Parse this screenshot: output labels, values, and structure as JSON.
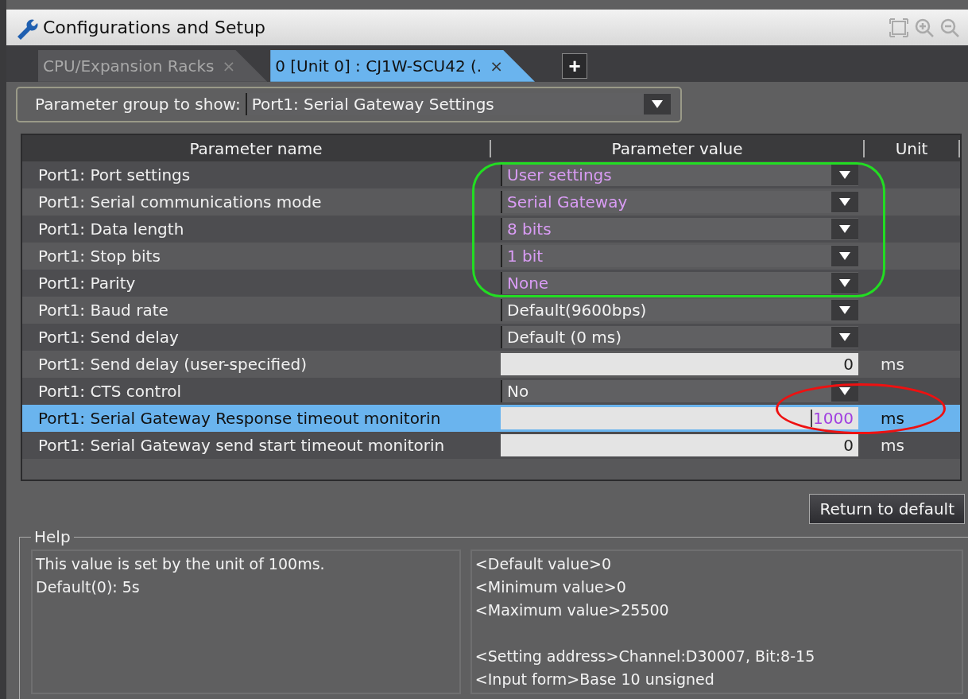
{
  "window": {
    "title": "Configurations and Setup"
  },
  "tabs": [
    {
      "label": "CPU/Expansion Racks",
      "close": "×",
      "selected": false
    },
    {
      "label": "0 [Unit 0] : CJ1W-SCU42 (.",
      "close": "×",
      "selected": true
    }
  ],
  "add_tab": "+",
  "parameter_group": {
    "label": "Parameter group to show:",
    "value": "Port1: Serial Gateway Settings"
  },
  "table": {
    "columns": [
      "Parameter name",
      "Parameter value",
      "Unit"
    ],
    "rows": [
      {
        "name": "Port1: Port settings",
        "kind": "select",
        "value": "User settings",
        "modified": true,
        "selected": false
      },
      {
        "name": "Port1: Serial communications mode",
        "kind": "select",
        "value": "Serial Gateway",
        "modified": true,
        "selected": false
      },
      {
        "name": "Port1: Data length",
        "kind": "select",
        "value": "8 bits",
        "modified": true,
        "selected": false
      },
      {
        "name": "Port1: Stop bits",
        "kind": "select",
        "value": "1 bit",
        "modified": true,
        "selected": false
      },
      {
        "name": "Port1: Parity",
        "kind": "select",
        "value": "None",
        "modified": true,
        "selected": false
      },
      {
        "name": "Port1: Baud rate",
        "kind": "select",
        "value": "Default(9600bps)",
        "modified": false,
        "selected": false
      },
      {
        "name": "Port1: Send delay",
        "kind": "select",
        "value": "Default (0 ms)",
        "modified": false,
        "selected": false
      },
      {
        "name": "Port1: Send delay (user-specified)",
        "kind": "input",
        "value": "0",
        "unit": "ms",
        "modified": false,
        "selected": false
      },
      {
        "name": "Port1: CTS control",
        "kind": "select",
        "value": "No",
        "modified": false,
        "selected": false
      },
      {
        "name": "Port1: Serial Gateway Response timeout monitorin",
        "kind": "input",
        "value": "1000",
        "unit": "ms",
        "modified": true,
        "selected": true
      },
      {
        "name": "Port1: Serial Gateway send start timeout monitorin",
        "kind": "input",
        "value": "0",
        "unit": "ms",
        "modified": false,
        "selected": false
      }
    ],
    "annotations": [
      {
        "kind": "box",
        "color": "#22dd22"
      },
      {
        "kind": "ellipse",
        "color": "#ee1111"
      }
    ]
  },
  "return_button": "Return to default",
  "help": {
    "title": "Help",
    "description": [
      "This value is set by the unit of 100ms.",
      "Default(0): 5s"
    ],
    "details": [
      [
        "<Default value>0",
        "<Minimum value>0",
        "<Maximum value>25500"
      ],
      [
        "<Setting address>Channel:D30007, Bit:8-15",
        "<Input form>Base 10 unsigned"
      ]
    ]
  }
}
